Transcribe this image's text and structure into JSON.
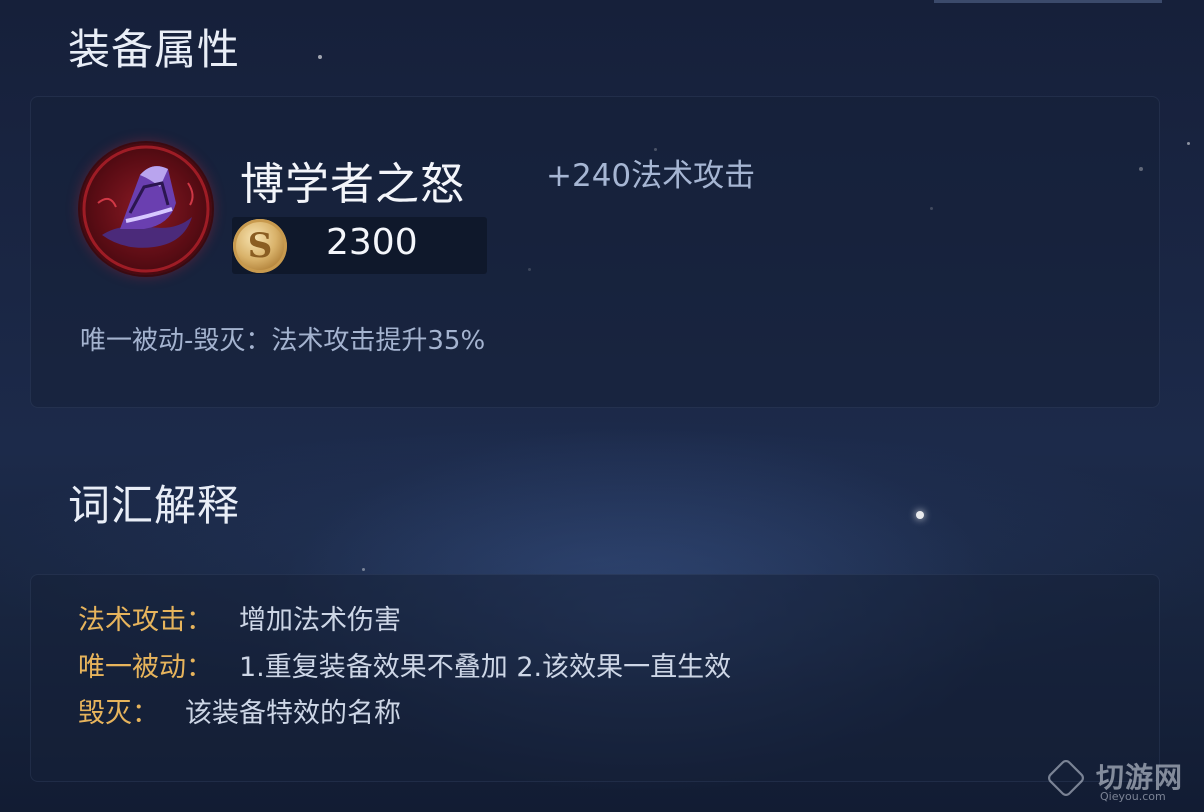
{
  "sections": {
    "attributes_title": "装备属性",
    "glossary_title": "词汇解释"
  },
  "item": {
    "name": "博学者之怒",
    "stat": "+240法术攻击",
    "price": "2300",
    "currency_icon": "gold-coin-icon",
    "passive": "唯一被动-毁灭：法术攻击提升35%"
  },
  "glossary": [
    {
      "term": "法术攻击：",
      "definition": "增加法术伤害"
    },
    {
      "term": "唯一被动：",
      "definition": "1.重复装备效果不叠加 2.该效果一直生效"
    },
    {
      "term": "毁灭：",
      "definition": "该装备特效的名称"
    }
  ],
  "watermark": {
    "text": "切游网",
    "url": "Qieyou.com"
  },
  "colors": {
    "glossary_term": "#e7b45c",
    "background": "#1a2644"
  }
}
